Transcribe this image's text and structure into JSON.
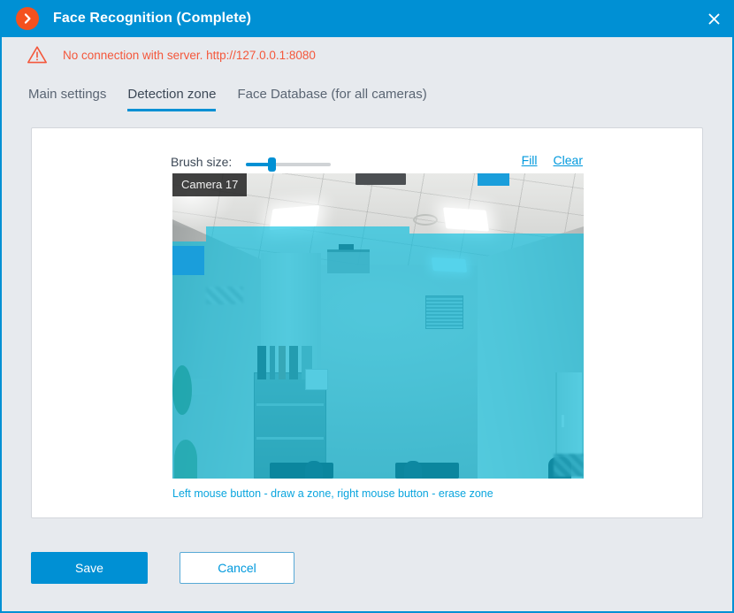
{
  "window": {
    "title": "Face Recognition (Complete)",
    "logo_icon": "chevron-right-circle-icon",
    "close_icon": "close-icon",
    "titlebar_color": "#0090d4",
    "accent_color": "#0090d4"
  },
  "alert": {
    "icon": "warning-triangle-icon",
    "message": "No connection with server. http://127.0.0.1:8080",
    "color": "#f4573b"
  },
  "tabs": [
    {
      "label": "Main settings",
      "active": false
    },
    {
      "label": "Detection zone",
      "active": true
    },
    {
      "label": "Face Database (for all cameras)",
      "active": false
    }
  ],
  "tools": {
    "brush_label": "Brush size:",
    "brush_value": 27,
    "brush_min": 0,
    "brush_max": 100,
    "fill_label": "Fill",
    "clear_label": "Clear"
  },
  "video": {
    "camera_label": "Camera 17",
    "zone_color": "#00bee1",
    "zone_solid_color": "#1a9edb"
  },
  "hint": {
    "text": "Left mouse button - draw a zone, right mouse button - erase zone",
    "color": "#0aa5de"
  },
  "footer": {
    "save_label": "Save",
    "cancel_label": "Cancel"
  }
}
